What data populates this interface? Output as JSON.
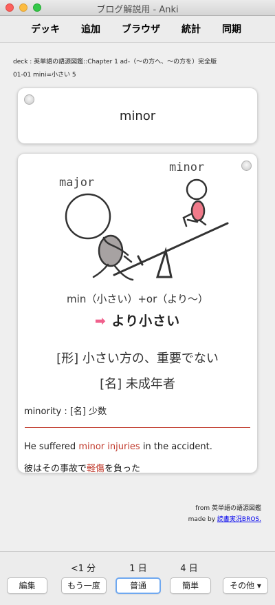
{
  "window": {
    "title": "ブログ解説用 - Anki"
  },
  "toolbar": {
    "decks": "デッキ",
    "add": "追加",
    "browse": "ブラウザ",
    "stats": "統計",
    "sync": "同期"
  },
  "deck_info": {
    "line1": "deck : 英単語の語源図鑑::Chapter 1 ad-（〜の方へ、〜の方を）完全版",
    "line2": "01-01 mini=小さい 5"
  },
  "front": {
    "word": "minor"
  },
  "illustration": {
    "label_major": "major",
    "label_minor": "minor"
  },
  "back": {
    "etymology": "min（小さい）+or（より〜）",
    "arrow": "➡",
    "meaning": "より小さい",
    "def1": "[形] 小さい方の、重要でない",
    "def2": "[名] 未成年者",
    "derivative": "minority : [名] 少数",
    "example_en": {
      "before": "He suffered ",
      "highlight": "minor injuries",
      "after": " in the accident."
    },
    "example_ja": {
      "before": "彼はその事故で",
      "highlight": "軽傷",
      "after": "を負った"
    }
  },
  "credit": {
    "line1": "from 英単語の語源図鑑",
    "line2_prefix": "made by ",
    "line2_link": "読書実況BROS."
  },
  "answer_bar": {
    "edit": "編集",
    "more": "その他 ▾",
    "buttons": [
      {
        "time": "<1 分",
        "label": "もう一度"
      },
      {
        "time": "1 日",
        "label": "普通"
      },
      {
        "time": "4 日",
        "label": "簡単"
      }
    ]
  },
  "colors": {
    "highlight": "#c0392b",
    "arrow": "#f0608c",
    "minor_figure": "#f07a8a"
  }
}
